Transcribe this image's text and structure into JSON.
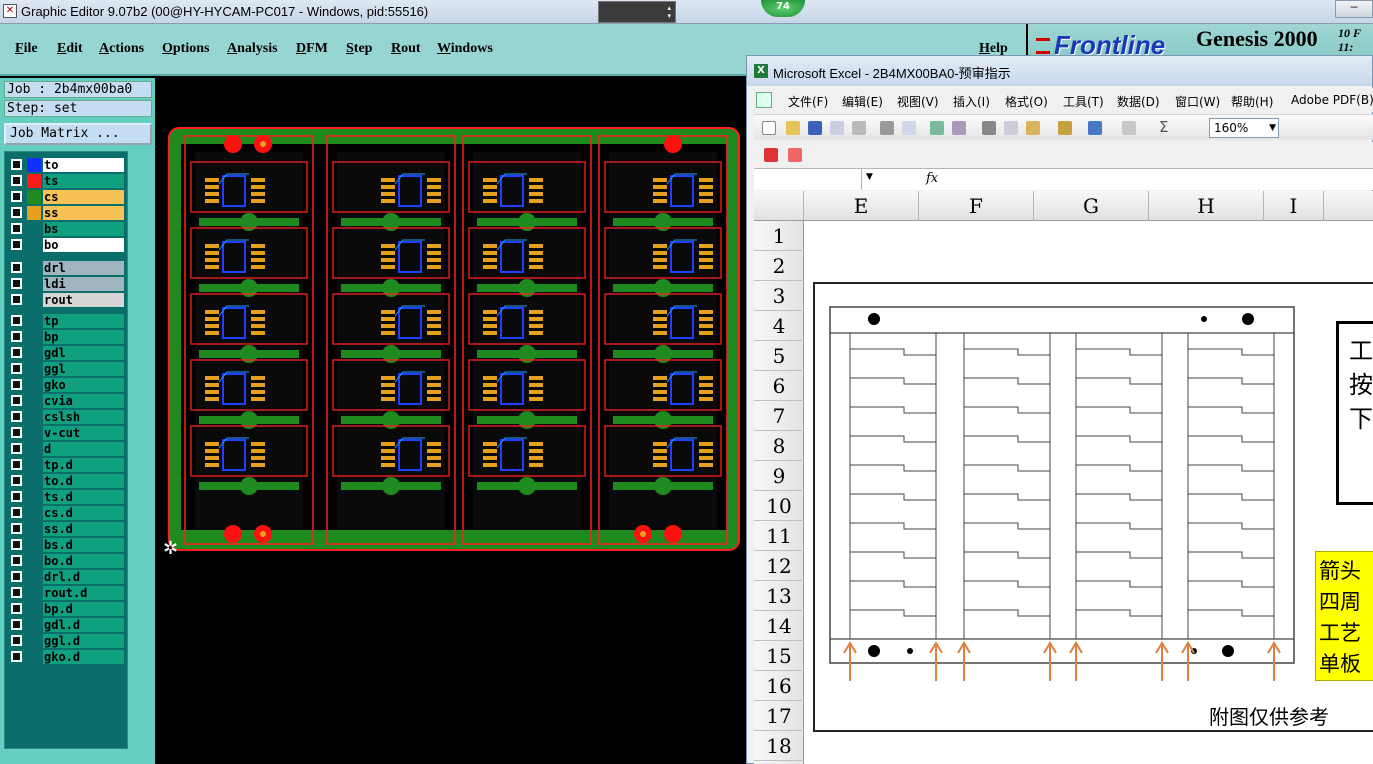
{
  "ge_window": {
    "title": "Graphic Editor 9.07b2 (00@HY-HYCAM-PC017 - Windows, pid:55516)",
    "badge": "74",
    "menu": [
      "File",
      "Edit",
      "Actions",
      "Options",
      "Analysis",
      "DFM",
      "Step",
      "Rout",
      "Windows"
    ],
    "help": "Help",
    "brand_logo": "Frontline",
    "brand_product": "Genesis 2000",
    "clock_line1": "10 F",
    "clock_line2": "11:",
    "job": "Job : 2b4mx00ba0",
    "step": "Step: set",
    "job_matrix": "Job Matrix ..."
  },
  "layers": {
    "group1": [
      {
        "name": "to",
        "swatch": "#1030ff",
        "bg": "#ffffff"
      },
      {
        "name": "ts",
        "swatch": "#ff1a1a",
        "bg": "#10a080",
        "mark": "⊞",
        "selected": true
      },
      {
        "name": "cs",
        "swatch": "#1f8a1f",
        "bg": "#f6c256"
      },
      {
        "name": "ss",
        "swatch": "#e6a020",
        "bg": "#f6c256"
      },
      {
        "name": "bs",
        "swatch": "#0b6e6a",
        "bg": "#10a080"
      },
      {
        "name": "bo",
        "swatch": "#0b6e6a",
        "bg": "#ffffff"
      }
    ],
    "group2": [
      {
        "name": "drl",
        "swatch": "#0b6e6a",
        "bg": "#9fb6c0"
      },
      {
        "name": "ldi",
        "swatch": "#0b6e6a",
        "bg": "#9fb6c0"
      },
      {
        "name": "rout",
        "swatch": "#0b6e6a",
        "bg": "#d6d6d6"
      }
    ],
    "group3": [
      {
        "name": "tp"
      },
      {
        "name": "bp"
      },
      {
        "name": "gdl"
      },
      {
        "name": "ggl"
      },
      {
        "name": "gko"
      },
      {
        "name": "cvia"
      },
      {
        "name": "cslsh"
      },
      {
        "name": "v-cut"
      },
      {
        "name": "d"
      },
      {
        "name": "tp.d"
      },
      {
        "name": "to.d"
      },
      {
        "name": "ts.d"
      },
      {
        "name": "cs.d"
      },
      {
        "name": "ss.d"
      },
      {
        "name": "bs.d"
      },
      {
        "name": "bo.d",
        "mark": "✎"
      },
      {
        "name": "drl.d"
      },
      {
        "name": "rout.d"
      },
      {
        "name": "bp.d"
      },
      {
        "name": "gdl.d",
        "mark": "✎"
      },
      {
        "name": "ggl.d"
      },
      {
        "name": "gko.d"
      }
    ]
  },
  "excel": {
    "title": "Microsoft Excel - 2B4MX00BA0-预审指示",
    "menu": [
      "文件(F)",
      "编辑(E)",
      "视图(V)",
      "插入(I)",
      "格式(O)",
      "工具(T)",
      "数据(D)",
      "窗口(W)",
      "帮助(H)",
      "Adobe PDF(B)"
    ],
    "zoom": "160%",
    "fx": "fx",
    "columns": [
      "E",
      "F",
      "G",
      "H",
      "I"
    ],
    "rows": [
      "1",
      "2",
      "3",
      "4",
      "5",
      "6",
      "7",
      "8",
      "9",
      "10",
      "11",
      "12",
      "13",
      "14",
      "15",
      "16",
      "17",
      "18"
    ],
    "note_box": [
      "工",
      "按",
      "下"
    ],
    "yellow_box": [
      "箭头",
      "四周",
      "工艺",
      "单板"
    ],
    "reference": "附图仅供参考"
  }
}
